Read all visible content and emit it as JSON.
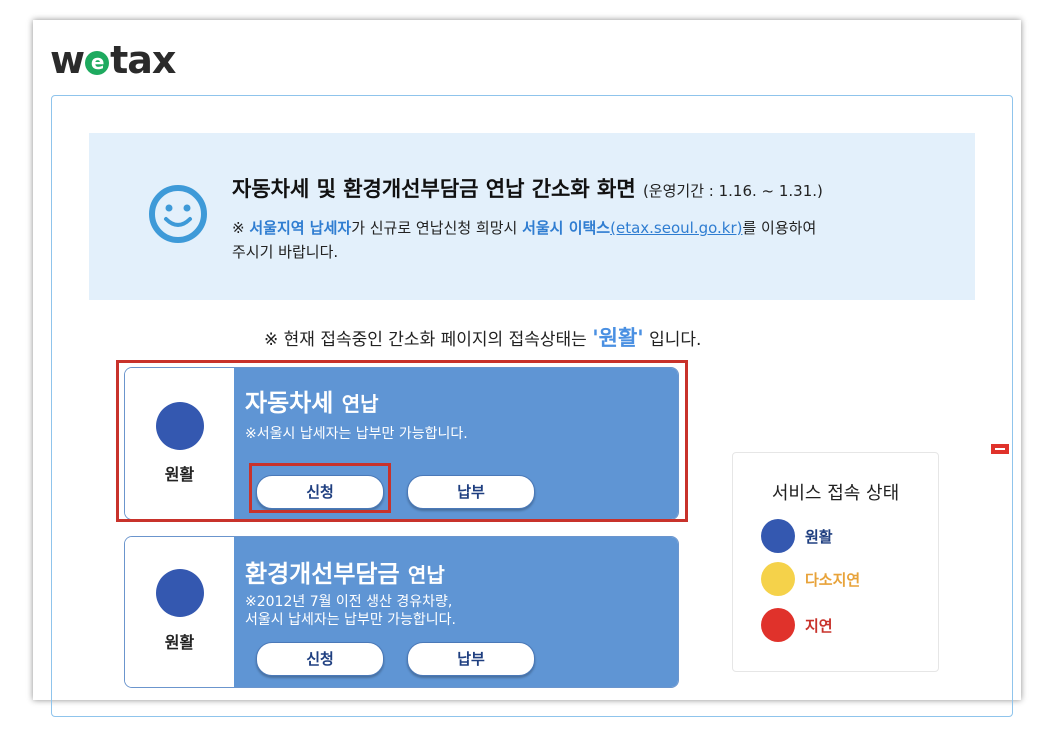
{
  "logo": {
    "prefix": "w",
    "e": "e",
    "suffix": "tax"
  },
  "notice": {
    "title": "자동차세 및 환경개선부담금 연납 간소화 화면",
    "period": "(운영기간 : 1.16. ~ 1.31.)",
    "mark": "※",
    "highlight1": "서울지역 납세자",
    "text1": "가 신규로 연납신청 희망시",
    "highlight2": "서울시 이택스",
    "link": "(etax.seoul.go.kr)",
    "text2": "를 이용하여",
    "line2": "주시기 바랍니다."
  },
  "status_line": {
    "prefix": "※ 현재 접속중인 간소화 페이지의 접속상태는",
    "status": "'원활'",
    "suffix": "입니다."
  },
  "cards": [
    {
      "status_label": "원활",
      "status_color": "#3458b0",
      "title_main": "자동차세",
      "title_sub": "연납",
      "desc": [
        "※서울시 납세자는 납부만 가능합니다."
      ],
      "apply_label": "신청",
      "pay_label": "납부"
    },
    {
      "status_label": "원활",
      "status_color": "#3458b0",
      "title_main": "환경개선부담금",
      "title_sub": "연납",
      "desc": [
        "※2012년 7월 이전 생산 경유차량,",
        "서울시 납세자는 납부만 가능합니다."
      ],
      "apply_label": "신청",
      "pay_label": "납부"
    }
  ],
  "legend": {
    "title": "서비스 접속 상태",
    "items": [
      {
        "label": "원활",
        "color": "#3458b0",
        "text_color": "#1f3f80"
      },
      {
        "label": "다소지연",
        "color": "#f5d24a",
        "text_color": "#e8a33a"
      },
      {
        "label": "지연",
        "color": "#e0322b",
        "text_color": "#c8322b"
      }
    ]
  }
}
